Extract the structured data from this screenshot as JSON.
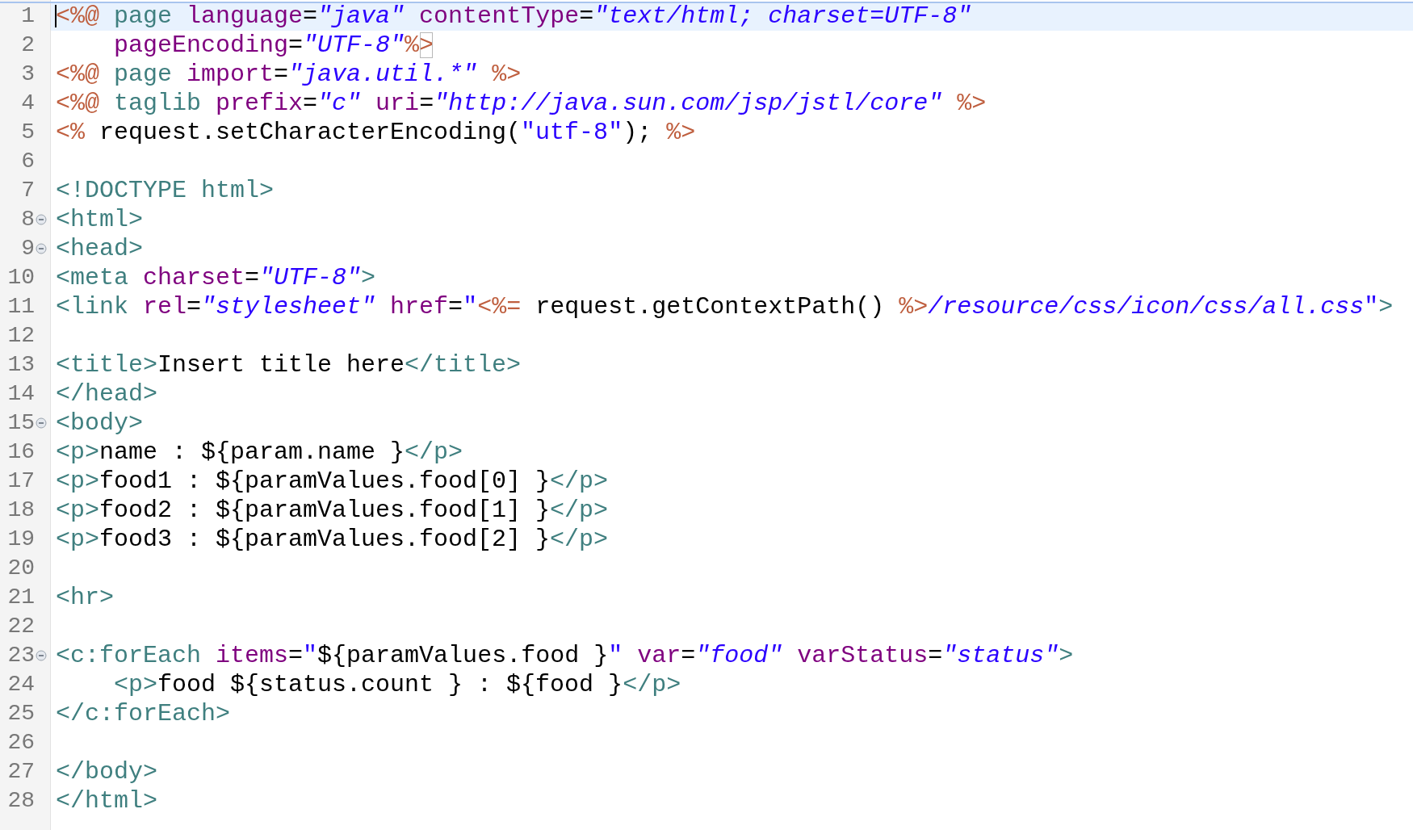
{
  "editor": {
    "lines": [
      {
        "number": "1",
        "current": true,
        "foldable": false,
        "tokens": [
          {
            "kind": "jsp",
            "text": "<%@"
          },
          {
            "kind": "tag",
            "text": " page"
          },
          {
            "kind": "attr",
            "text": " language"
          },
          {
            "kind": "text",
            "text": "="
          },
          {
            "kind": "value",
            "text": "\"java\""
          },
          {
            "kind": "attr",
            "text": " contentType"
          },
          {
            "kind": "text",
            "text": "="
          },
          {
            "kind": "value",
            "text": "\"text/html; charset=UTF-8\""
          }
        ]
      },
      {
        "number": "2",
        "current": false,
        "foldable": false,
        "tokens": [
          {
            "kind": "attr",
            "text": "    pageEncoding"
          },
          {
            "kind": "text",
            "text": "="
          },
          {
            "kind": "value",
            "text": "\"UTF-8\""
          },
          {
            "kind": "jsp",
            "text": "%"
          },
          {
            "kind": "jsp_matched",
            "text": ">"
          }
        ]
      },
      {
        "number": "3",
        "current": false,
        "foldable": false,
        "tokens": [
          {
            "kind": "jsp",
            "text": "<%@"
          },
          {
            "kind": "tag",
            "text": " page"
          },
          {
            "kind": "attr",
            "text": " import"
          },
          {
            "kind": "text",
            "text": "="
          },
          {
            "kind": "value",
            "text": "\"java.util.*\""
          },
          {
            "kind": "jsp",
            "text": " %>"
          }
        ]
      },
      {
        "number": "4",
        "current": false,
        "foldable": false,
        "tokens": [
          {
            "kind": "jsp",
            "text": "<%@"
          },
          {
            "kind": "tag",
            "text": " taglib"
          },
          {
            "kind": "attr",
            "text": " prefix"
          },
          {
            "kind": "text",
            "text": "="
          },
          {
            "kind": "value",
            "text": "\"c\""
          },
          {
            "kind": "attr",
            "text": " uri"
          },
          {
            "kind": "text",
            "text": "="
          },
          {
            "kind": "value",
            "text": "\"http://java.sun.com/jsp/jstl/core\""
          },
          {
            "kind": "jsp",
            "text": " %>"
          }
        ]
      },
      {
        "number": "5",
        "current": false,
        "foldable": false,
        "tokens": [
          {
            "kind": "jsp",
            "text": "<%"
          },
          {
            "kind": "text",
            "text": " request.setCharacterEncoding("
          },
          {
            "kind": "string",
            "text": "\"utf-8\""
          },
          {
            "kind": "text",
            "text": ");"
          },
          {
            "kind": "jsp",
            "text": " %>"
          }
        ]
      },
      {
        "number": "6",
        "current": false,
        "foldable": false
      },
      {
        "number": "7",
        "current": false,
        "foldable": false,
        "tokens": [
          {
            "kind": "tag",
            "text": "<!DOCTYPE html>"
          }
        ]
      },
      {
        "number": "8",
        "current": false,
        "foldable": true,
        "tokens": [
          {
            "kind": "tag",
            "text": "<html>"
          }
        ]
      },
      {
        "number": "9",
        "current": false,
        "foldable": true,
        "tokens": [
          {
            "kind": "tag",
            "text": "<head>"
          }
        ]
      },
      {
        "number": "10",
        "current": false,
        "foldable": false,
        "tokens": [
          {
            "kind": "tag",
            "text": "<meta"
          },
          {
            "kind": "attr",
            "text": " charset"
          },
          {
            "kind": "text",
            "text": "="
          },
          {
            "kind": "value",
            "text": "\"UTF-8\""
          },
          {
            "kind": "tag",
            "text": ">"
          }
        ]
      },
      {
        "number": "11",
        "current": false,
        "foldable": false,
        "tokens": [
          {
            "kind": "tag",
            "text": "<link"
          },
          {
            "kind": "attr",
            "text": " rel"
          },
          {
            "kind": "text",
            "text": "="
          },
          {
            "kind": "value",
            "text": "\"stylesheet\""
          },
          {
            "kind": "attr",
            "text": " href"
          },
          {
            "kind": "text",
            "text": "="
          },
          {
            "kind": "string",
            "text": "\""
          },
          {
            "kind": "jsp",
            "text": "<%="
          },
          {
            "kind": "text",
            "text": " request.getContextPath()"
          },
          {
            "kind": "jsp",
            "text": " %>"
          },
          {
            "kind": "value",
            "text": "/resource/css/icon/css/all.css"
          },
          {
            "kind": "string",
            "text": "\""
          },
          {
            "kind": "tag",
            "text": ">"
          }
        ]
      },
      {
        "number": "12",
        "current": false,
        "foldable": false
      },
      {
        "number": "13",
        "current": false,
        "foldable": false,
        "tokens": [
          {
            "kind": "tag",
            "text": "<title>"
          },
          {
            "kind": "text",
            "text": "Insert title here"
          },
          {
            "kind": "tag",
            "text": "</title>"
          }
        ]
      },
      {
        "number": "14",
        "current": false,
        "foldable": false,
        "tokens": [
          {
            "kind": "tag",
            "text": "</head>"
          }
        ]
      },
      {
        "number": "15",
        "current": false,
        "foldable": true,
        "tokens": [
          {
            "kind": "tag",
            "text": "<body>"
          }
        ]
      },
      {
        "number": "16",
        "current": false,
        "foldable": false,
        "tokens": [
          {
            "kind": "tag",
            "text": "<p>"
          },
          {
            "kind": "text",
            "text": "name : ${param.name }"
          },
          {
            "kind": "tag",
            "text": "</p>"
          }
        ]
      },
      {
        "number": "17",
        "current": false,
        "foldable": false,
        "tokens": [
          {
            "kind": "tag",
            "text": "<p>"
          },
          {
            "kind": "text",
            "text": "food1 : ${paramValues.food[0] }"
          },
          {
            "kind": "tag",
            "text": "</p>"
          }
        ]
      },
      {
        "number": "18",
        "current": false,
        "foldable": false,
        "tokens": [
          {
            "kind": "tag",
            "text": "<p>"
          },
          {
            "kind": "text",
            "text": "food2 : ${paramValues.food[1] }"
          },
          {
            "kind": "tag",
            "text": "</p>"
          }
        ]
      },
      {
        "number": "19",
        "current": false,
        "foldable": false,
        "tokens": [
          {
            "kind": "tag",
            "text": "<p>"
          },
          {
            "kind": "text",
            "text": "food3 : ${paramValues.food[2] }"
          },
          {
            "kind": "tag",
            "text": "</p>"
          }
        ]
      },
      {
        "number": "20",
        "current": false,
        "foldable": false
      },
      {
        "number": "21",
        "current": false,
        "foldable": false,
        "tokens": [
          {
            "kind": "tag",
            "text": "<hr>"
          }
        ]
      },
      {
        "number": "22",
        "current": false,
        "foldable": false
      },
      {
        "number": "23",
        "current": false,
        "foldable": true,
        "tokens": [
          {
            "kind": "tag",
            "text": "<c:forEach"
          },
          {
            "kind": "attr",
            "text": " items"
          },
          {
            "kind": "text",
            "text": "="
          },
          {
            "kind": "string",
            "text": "\""
          },
          {
            "kind": "text",
            "text": "${paramValues.food }"
          },
          {
            "kind": "string",
            "text": "\""
          },
          {
            "kind": "attr",
            "text": " var"
          },
          {
            "kind": "text",
            "text": "="
          },
          {
            "kind": "value",
            "text": "\"food\""
          },
          {
            "kind": "attr",
            "text": " varStatus"
          },
          {
            "kind": "text",
            "text": "="
          },
          {
            "kind": "value",
            "text": "\"status\""
          },
          {
            "kind": "tag",
            "text": ">"
          }
        ]
      },
      {
        "number": "24",
        "current": false,
        "foldable": false,
        "tokens": [
          {
            "kind": "tag",
            "text": "    <p>"
          },
          {
            "kind": "text",
            "text": "food ${status.count } : ${food }"
          },
          {
            "kind": "tag",
            "text": "</p>"
          }
        ]
      },
      {
        "number": "25",
        "current": false,
        "foldable": false,
        "tokens": [
          {
            "kind": "tag",
            "text": "</c:forEach>"
          }
        ]
      },
      {
        "number": "26",
        "current": false,
        "foldable": false
      },
      {
        "number": "27",
        "current": false,
        "foldable": false,
        "tokens": [
          {
            "kind": "tag",
            "text": "</body>"
          }
        ]
      },
      {
        "number": "28",
        "current": false,
        "foldable": false,
        "tokens": [
          {
            "kind": "tag",
            "text": "</html>"
          }
        ]
      }
    ]
  }
}
